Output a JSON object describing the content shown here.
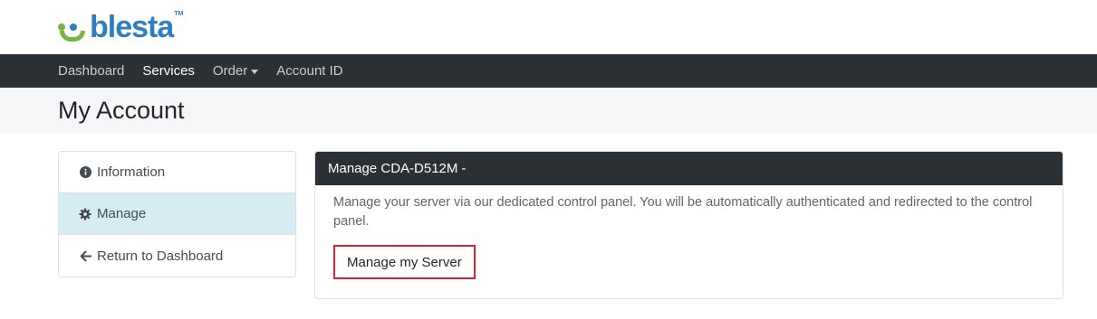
{
  "brand": {
    "name": "blesta",
    "tm": "TM"
  },
  "nav": {
    "items": [
      {
        "label": "Dashboard"
      },
      {
        "label": "Services"
      },
      {
        "label": "Order"
      },
      {
        "label": "Account ID"
      }
    ]
  },
  "page": {
    "title": "My Account"
  },
  "sidebar": {
    "items": [
      {
        "label": "Information",
        "icon": "info-circle-icon"
      },
      {
        "label": "Manage",
        "icon": "cog-icon"
      },
      {
        "label": "Return to Dashboard",
        "icon": "arrow-left-icon"
      }
    ]
  },
  "panel": {
    "title": "Manage CDA-D512M -",
    "description": "Manage your server via our dedicated control panel. You will be automatically authenticated and redirected to the control panel.",
    "button_label": "Manage my Server"
  },
  "colors": {
    "navbar": "#2b3034",
    "active_sidebar": "#d4ecf2",
    "brand_blue": "#2f7ec1",
    "brand_green": "#7ab543",
    "highlight_red": "#d9232e"
  }
}
